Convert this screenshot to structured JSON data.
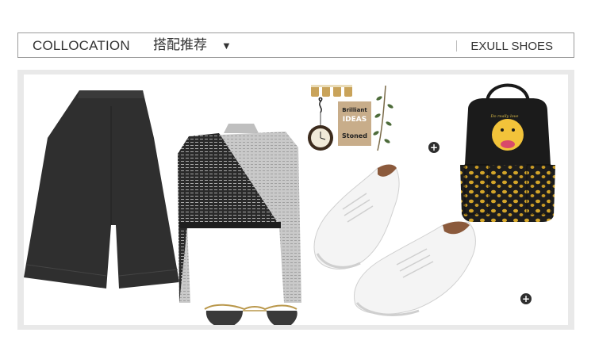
{
  "header": {
    "title": "COLLOCATION",
    "subtitle": "搭配推荐",
    "dropdown_arrow": "▼",
    "brand_link": "EXULL SHOES"
  },
  "collage": {
    "notebook_text_1": "Brilliant",
    "notebook_text_2": "IDEAS",
    "notebook_text_3": "Stoned",
    "backpack_script": "Do really love",
    "plus_label": "+"
  },
  "colors": {
    "border": "#9b9b9b",
    "panel_bg": "#e9e9e9",
    "text": "#333333",
    "plus_button": "#2e2e2e"
  },
  "icons": [
    "dropdown-arrow-icon",
    "plus-icon"
  ]
}
